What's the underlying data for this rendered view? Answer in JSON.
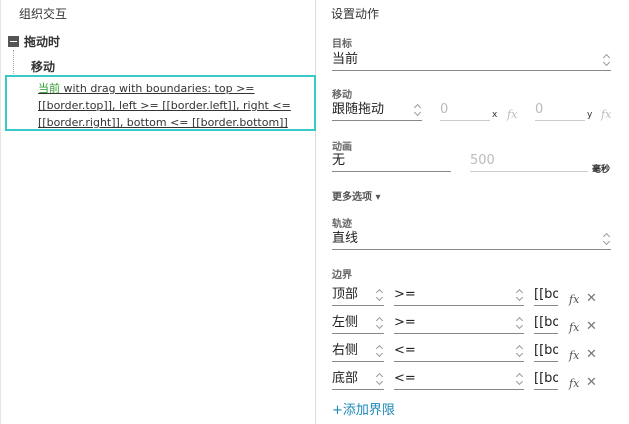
{
  "left_panel": {
    "title": "组织交互",
    "event": {
      "label": "拖动时"
    },
    "case": {
      "label": "移动"
    },
    "action": {
      "target": "当前",
      "text_line1": " with drag  with boundaries: top >=",
      "text_line2": "[[border.top]], left >= [[border.left]], right <=",
      "text_line3": "[[border.right]], bottom <= [[border.bottom]]"
    }
  },
  "right_panel": {
    "title": "设置动作",
    "target": {
      "label": "目标",
      "value": "当前"
    },
    "move": {
      "label": "移动",
      "value": "跟随拖动",
      "x_value": "0",
      "x_label": "x",
      "y_value": "0",
      "y_label": "y"
    },
    "animation": {
      "label": "动画",
      "value": "无",
      "duration": "500",
      "unit": "毫秒"
    },
    "more_options": "更多选项 ▾",
    "track": {
      "label": "轨迹",
      "value": "直线"
    },
    "boundaries": {
      "label": "边界",
      "rows": [
        {
          "side": "顶部",
          "op": ">=",
          "value": "[[bo"
        },
        {
          "side": "左侧",
          "op": ">=",
          "value": "[[bo"
        },
        {
          "side": "右侧",
          "op": "<=",
          "value": "[[bo"
        },
        {
          "side": "底部",
          "op": "<=",
          "value": "[[bo"
        }
      ]
    },
    "add_boundary": "+添加界限",
    "fx_symbol": "fx",
    "close_symbol": "✕"
  }
}
